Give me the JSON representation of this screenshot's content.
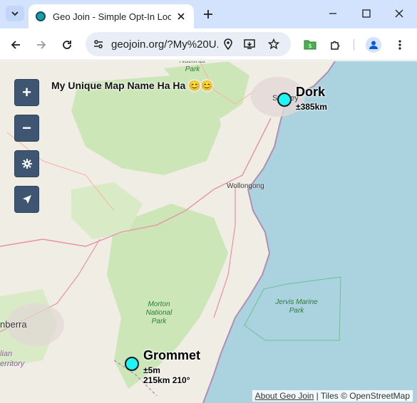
{
  "browser": {
    "tab_title": "Geo Join - Simple Opt-In Location",
    "url": "geojoin.org/?My%20U..."
  },
  "map": {
    "name": "My Unique Map Name Ha Ha 😊😊",
    "zoom_in_label": "+",
    "zoom_out_label": "−",
    "places": {
      "sydney": "Sydney",
      "wollongong": "Wollongong",
      "canberra": "nberra",
      "territory": "erritory",
      "australian": "lian",
      "national_park_top": "National Park",
      "morton": "Morton National Park",
      "jervis": "Jervis Marine Park"
    },
    "markers": [
      {
        "name": "Dork",
        "detail_line1": "±385km",
        "detail_line2": ""
      },
      {
        "name": "Grommet",
        "detail_line1": "±5m",
        "detail_line2": "215km 210°"
      }
    ],
    "attribution": {
      "link_label": "About Geo Join",
      "separator": " | ",
      "tiles_label": "Tiles © OpenStreetMap"
    },
    "colors": {
      "sea": "#aad3df",
      "park": "#cde6b8",
      "button": "#3f5673",
      "marker": "#1ff5f5"
    }
  }
}
